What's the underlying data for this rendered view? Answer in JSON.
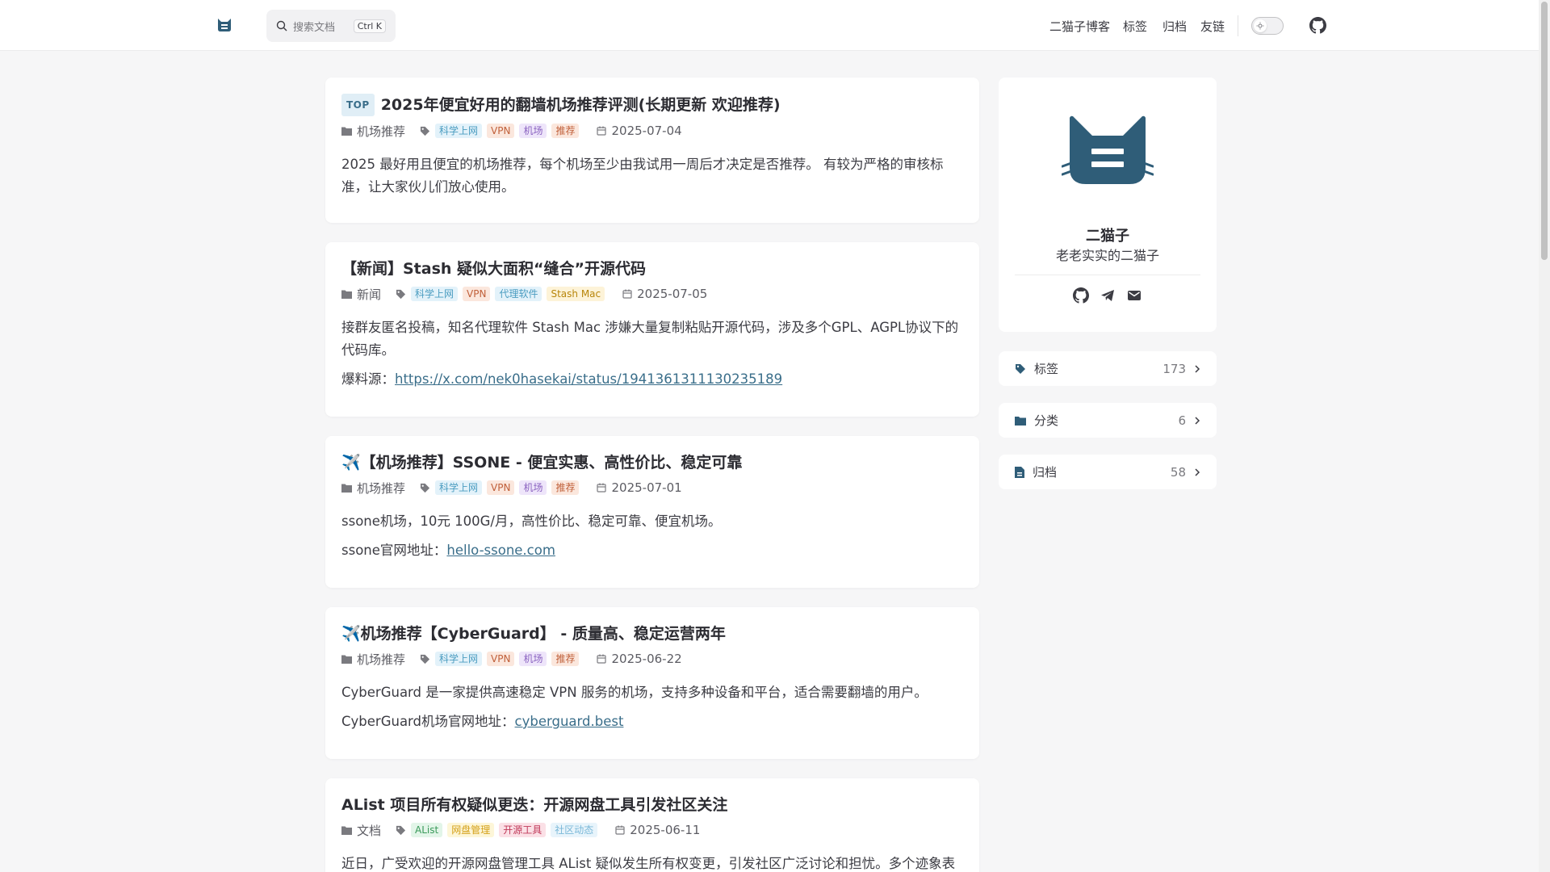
{
  "header": {
    "search_placeholder": "搜索文档",
    "search_shortcut": "Ctrl K",
    "nav": [
      "二猫子博客",
      "标签",
      "归档",
      "友链"
    ]
  },
  "posts": [
    {
      "top_badge": "TOP",
      "title": "2025年便宜好用的翻墙机场推荐评测(长期更新 欢迎推荐)",
      "category": "机场推荐",
      "tags": [
        {
          "label": "科学上网",
          "color": "#4a9cc0",
          "bg": "#e3f2fa"
        },
        {
          "label": "VPN",
          "color": "#c0603a",
          "bg": "#fbe7dd"
        },
        {
          "label": "机场",
          "color": "#8a62c0",
          "bg": "#eee5fa"
        },
        {
          "label": "推荐",
          "color": "#c0603a",
          "bg": "#fbe7dd"
        }
      ],
      "date": "2025-07-04",
      "paragraphs": [
        {
          "text": "2025 最好用且便宜的机场推荐，每个机场至少由我试用一周后才决定是否推荐。 有较为严格的审核标准，让大家伙儿们放心使用。",
          "link": ""
        }
      ]
    },
    {
      "top_badge": "",
      "title": "【新闻】Stash 疑似大面积“缝合”开源代码",
      "category": "新闻",
      "tags": [
        {
          "label": "科学上网",
          "color": "#4a9cc0",
          "bg": "#e3f2fa"
        },
        {
          "label": "VPN",
          "color": "#c0603a",
          "bg": "#fbe7dd"
        },
        {
          "label": "代理软件",
          "color": "#4a9cc0",
          "bg": "#e3f2fa"
        },
        {
          "label": "Stash Mac",
          "color": "#b8860b",
          "bg": "#fdf3d8"
        }
      ],
      "date": "2025-07-05",
      "paragraphs": [
        {
          "text": "接群友匿名投稿，知名代理软件 Stash Mac 涉嫌大量复制粘贴开源代码，涉及多个GPL、AGPL协议下的代码库。",
          "link": ""
        },
        {
          "text": "爆料源：",
          "link": "https://x.com/nek0hasekai/status/1941361311130235189"
        }
      ]
    },
    {
      "top_badge": "",
      "title": "✈️【机场推荐】SSONE - 便宜实惠、高性价比、稳定可靠",
      "category": "机场推荐",
      "tags": [
        {
          "label": "科学上网",
          "color": "#4a9cc0",
          "bg": "#e3f2fa"
        },
        {
          "label": "VPN",
          "color": "#c0603a",
          "bg": "#fbe7dd"
        },
        {
          "label": "机场",
          "color": "#8a62c0",
          "bg": "#eee5fa"
        },
        {
          "label": "推荐",
          "color": "#c0603a",
          "bg": "#fbe7dd"
        }
      ],
      "date": "2025-07-01",
      "paragraphs": [
        {
          "text": "ssone机场，10元 100G/月，高性价比、稳定可靠、便宜机场。",
          "link": ""
        },
        {
          "text": "ssone官网地址：",
          "link": "hello-ssone.com"
        }
      ]
    },
    {
      "top_badge": "",
      "title": "✈️机场推荐【CyberGuard】 - 质量高、稳定运营两年",
      "category": "机场推荐",
      "tags": [
        {
          "label": "科学上网",
          "color": "#4a9cc0",
          "bg": "#e3f2fa"
        },
        {
          "label": "VPN",
          "color": "#c0603a",
          "bg": "#fbe7dd"
        },
        {
          "label": "机场",
          "color": "#8a62c0",
          "bg": "#eee5fa"
        },
        {
          "label": "推荐",
          "color": "#c0603a",
          "bg": "#fbe7dd"
        }
      ],
      "date": "2025-06-22",
      "paragraphs": [
        {
          "text": "CyberGuard 是一家提供高速稳定 VPN 服务的机场，支持多种设备和平台，适合需要翻墙的用户。",
          "link": ""
        },
        {
          "text": "CyberGuard机场官网地址：",
          "link": "cyberguard.best"
        }
      ]
    },
    {
      "top_badge": "",
      "title": "AList 项目所有权疑似更迭：开源网盘工具引发社区关注",
      "category": "文档",
      "tags": [
        {
          "label": "AList",
          "color": "#3a9a5a",
          "bg": "#e2f5e8"
        },
        {
          "label": "网盘管理",
          "color": "#d4a017",
          "bg": "#fdf6d8"
        },
        {
          "label": "开源工具",
          "color": "#c03a5a",
          "bg": "#fbe0e6"
        },
        {
          "label": "社区动态",
          "color": "#7ab8d8",
          "bg": "#e8f4fb"
        }
      ],
      "date": "2025-06-11",
      "paragraphs": [
        {
          "text": "近日，广受欢迎的开源网盘管理工具 AList 疑似发生所有权变更，引发社区广泛讨论和担忧。多个迹象表明项",
          "link": ""
        }
      ]
    }
  ],
  "profile": {
    "name": "二猫子",
    "bio": "老老实实的二猫子",
    "socials": [
      "github-icon",
      "telegram-icon",
      "mail-icon"
    ]
  },
  "sidebar": [
    {
      "icon": "tag-icon",
      "label": "标签",
      "count": "173"
    },
    {
      "icon": "folder-icon",
      "label": "分类",
      "count": "6"
    },
    {
      "icon": "archive-icon",
      "label": "归档",
      "count": "58"
    }
  ],
  "colors": {
    "accent": "#2f5d78",
    "link": "#3a6e8a",
    "background": "#f6f6f7"
  }
}
